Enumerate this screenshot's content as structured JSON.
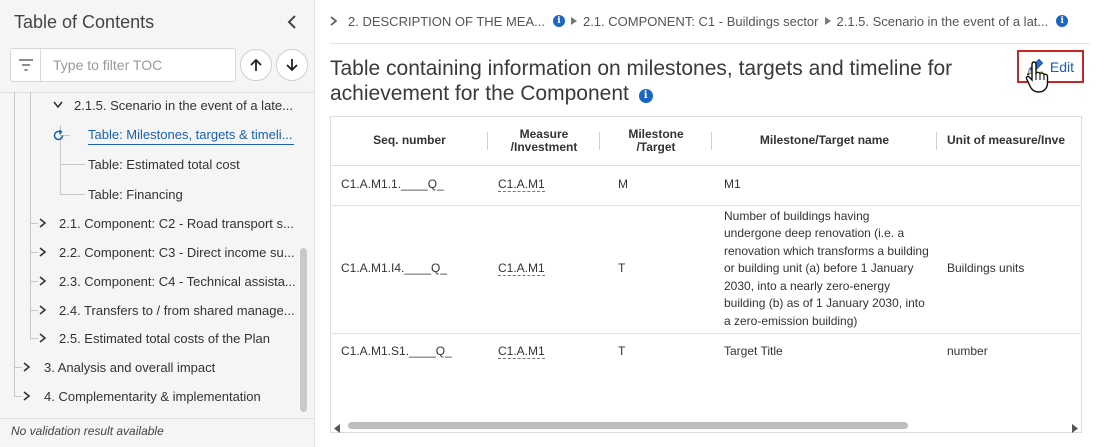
{
  "sidebar": {
    "title": "Table of Contents",
    "filter_placeholder": "Type to filter TOC",
    "status": "No validation result available",
    "tree": [
      {
        "label": "2.1.5. Scenario in the event of a late..."
      },
      {
        "label": "Table: Milestones, targets & timeli...",
        "active": true
      },
      {
        "label": "Table: Estimated total cost"
      },
      {
        "label": "Table: Financing"
      },
      {
        "label": "2.1. Component: C2 - Road transport s..."
      },
      {
        "label": "2.2. Component: C3 - Direct income su..."
      },
      {
        "label": "2.3. Component: C4 - Technical assista..."
      },
      {
        "label": "2.4. Transfers to / from shared manage..."
      },
      {
        "label": "2.5. Estimated total costs of the Plan"
      },
      {
        "label": "3. Analysis and overall impact"
      },
      {
        "label": "4. Complementarity & implementation"
      }
    ]
  },
  "breadcrumb": [
    {
      "label": "2. DESCRIPTION OF THE MEA..."
    },
    {
      "label": "2.1. COMPONENT: C1 - Buildings sector"
    },
    {
      "label": "2.1.5. Scenario in the event of a lat..."
    }
  ],
  "main": {
    "title": "Table containing information on milestones, targets and timeline for achievement for the Component",
    "edit_label": "Edit"
  },
  "table": {
    "headers": [
      "Seq. number",
      "Measure /Investment",
      "Milestone /Target",
      "Milestone/Target name",
      "Unit of measure/Inve"
    ],
    "rows": [
      {
        "seq": "C1.A.M1.1.____Q_",
        "measure": "C1.A.M1",
        "type": "M",
        "name": "M1",
        "unit": ""
      },
      {
        "seq": "C1.A.M1.I4.____Q_",
        "measure": "C1.A.M1",
        "type": "T",
        "name": "Number of buildings having undergone deep renovation (i.e. a renovation which transforms a building or building unit (a) before 1 January 2030, into a nearly zero-energy building (b) as of 1 January 2030, into a zero-emission building)",
        "unit": "Buildings units"
      },
      {
        "seq": "C1.A.M1.S1.____Q_",
        "measure": "C1.A.M1",
        "type": "T",
        "name": "Target Title",
        "unit": "number"
      }
    ]
  },
  "colors": {
    "accent": "#1a5fb4",
    "info": "#1a66c2",
    "edit_border": "#c62828"
  }
}
